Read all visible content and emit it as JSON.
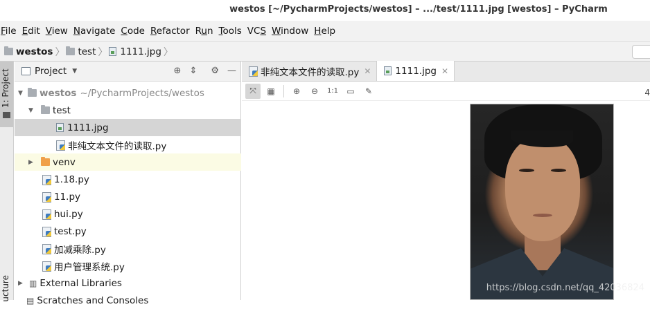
{
  "title": "westos [~/PycharmProjects/westos] – .../test/1111.jpg [westos] – PyCharm",
  "menu": [
    {
      "label": "File",
      "u": "F",
      "rest": "ile"
    },
    {
      "label": "Edit",
      "u": "E",
      "rest": "dit"
    },
    {
      "label": "View",
      "u": "V",
      "rest": "iew"
    },
    {
      "label": "Navigate",
      "u": "N",
      "rest": "avigate"
    },
    {
      "label": "Code",
      "u": "C",
      "rest": "ode"
    },
    {
      "label": "Refactor",
      "u": "R",
      "rest": "efactor"
    },
    {
      "label": "Run",
      "pre": "R",
      "u": "u",
      "rest": "n"
    },
    {
      "label": "Tools",
      "u": "T",
      "rest": "ools"
    },
    {
      "label": "VCS",
      "pre": "VC",
      "u": "S",
      "rest": ""
    },
    {
      "label": "Window",
      "u": "W",
      "rest": "indow"
    },
    {
      "label": "Help",
      "u": "H",
      "rest": "elp"
    }
  ],
  "breadcrumb": {
    "root": "westos",
    "folder": "test",
    "file": "1111.jpg"
  },
  "side_tabs": {
    "project": "1: Project",
    "structure": "ucture"
  },
  "project_panel": {
    "title": "Project",
    "root_name": "westos",
    "root_path": "~/PycharmProjects/westos",
    "test_folder": "test",
    "test_children": [
      "1111.jpg",
      "非纯文本文件的读取.py"
    ],
    "venv": "venv",
    "files": [
      "1.18.py",
      "11.py",
      "hui.py",
      "test.py",
      "加减乘除.py",
      "用户管理系统.py"
    ],
    "external": "External Libraries",
    "scratches": "Scratches and Consoles"
  },
  "editor": {
    "tabs": [
      "非纯文本文件的读取.py",
      "1111.jpg"
    ],
    "active_tab": 1,
    "zoom_actual": "1:1",
    "right_digit": "4",
    "watermark": "https://blog.csdn.net/qq_42036824"
  }
}
